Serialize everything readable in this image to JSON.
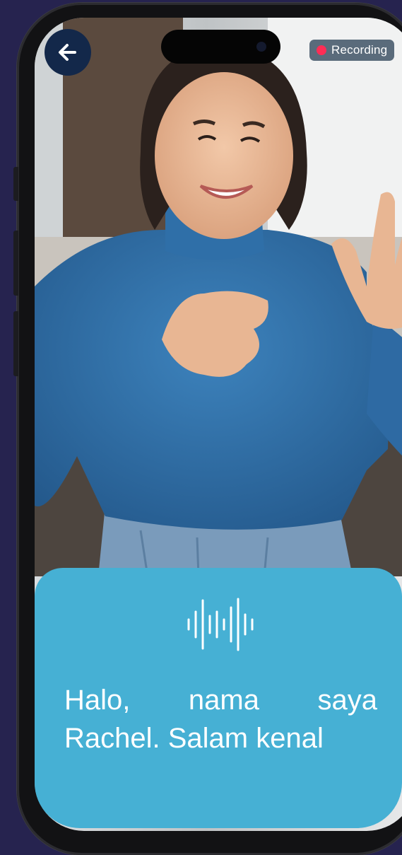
{
  "status": {
    "recording_label": "Recording"
  },
  "caption": {
    "text": "Halo, nama saya Rachel. Salam kenal"
  },
  "icons": {
    "back": "arrow-left-icon",
    "recording": "record-dot-icon",
    "audio": "audio-waveform-icon"
  },
  "colors": {
    "background": "#26234f",
    "caption_panel": "#46b0d4",
    "back_button": "#13284a",
    "recording_dot": "#ff2d55"
  }
}
